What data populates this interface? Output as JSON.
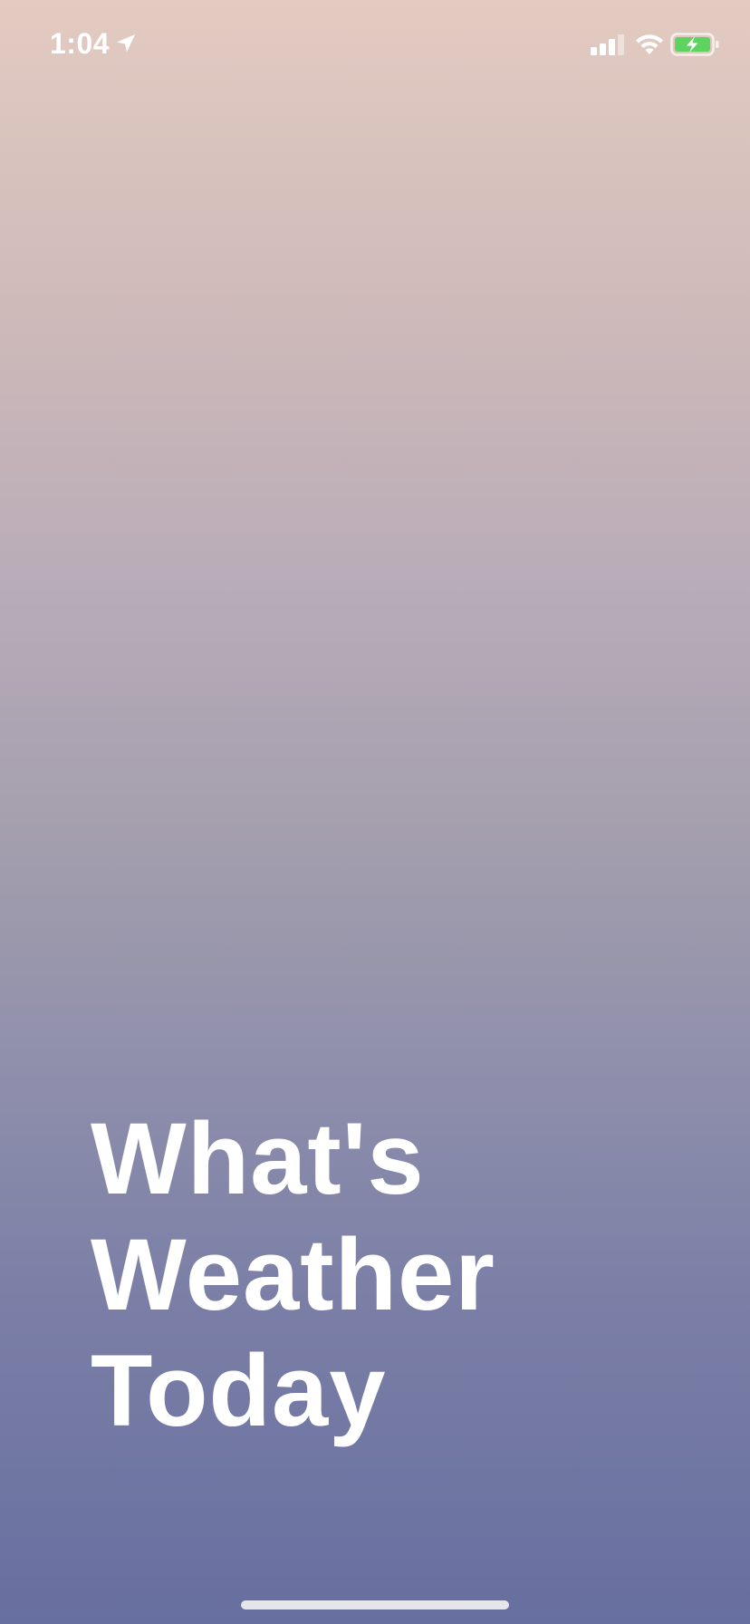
{
  "status_bar": {
    "time": "1:04",
    "icons": [
      "location-arrow-icon",
      "cellular-signal-icon",
      "wifi-icon",
      "battery-charging-icon"
    ],
    "battery_color": "#5fd35f"
  },
  "headline": {
    "lines": [
      "What's",
      "Weather",
      "Today"
    ]
  },
  "colors": {
    "gradient_top": "#e3cbc1",
    "gradient_bottom": "#676fa0",
    "text": "#ffffff"
  }
}
